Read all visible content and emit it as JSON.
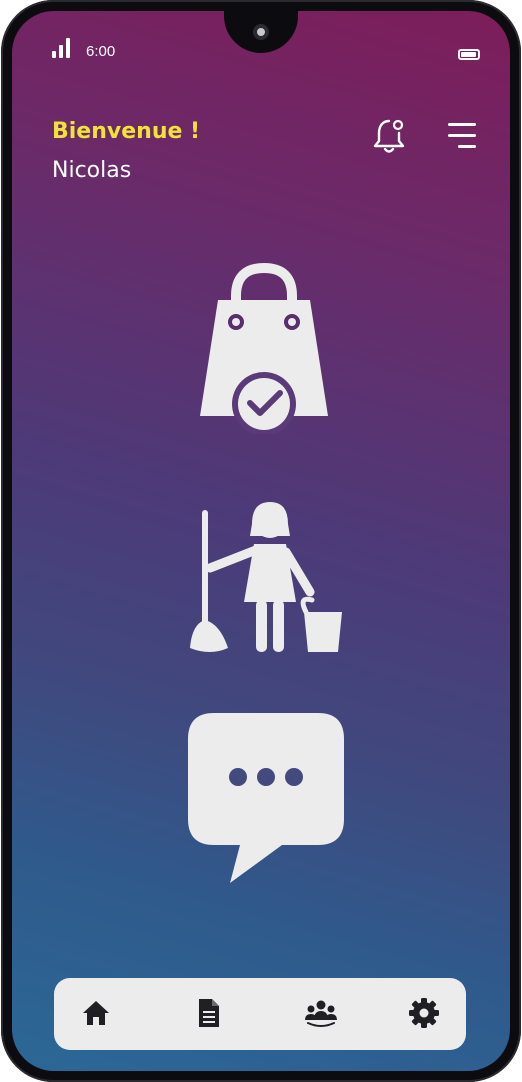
{
  "status_bar": {
    "time": "6:00",
    "signal_icon": "signal-bars-icon",
    "battery_icon": "battery-icon"
  },
  "header": {
    "greeting": "Bienvenue !",
    "username": "Nicolas",
    "notification_icon": "bell-icon",
    "menu_icon": "hamburger-menu-icon"
  },
  "features": [
    {
      "icon": "shopping-bag-check-icon"
    },
    {
      "icon": "cleaning-lady-icon"
    },
    {
      "icon": "chat-bubble-icon"
    }
  ],
  "bottom_nav": {
    "items": [
      {
        "icon": "home-icon"
      },
      {
        "icon": "document-icon"
      },
      {
        "icon": "group-icon"
      },
      {
        "icon": "gear-icon"
      }
    ]
  },
  "colors": {
    "greeting": "#f1e23a",
    "gradient_top": "#7d1d5a",
    "gradient_bottom": "#2b6896",
    "icon_fill": "#ececec",
    "nav_bg": "#ececec",
    "nav_icon": "#1f1f24"
  }
}
